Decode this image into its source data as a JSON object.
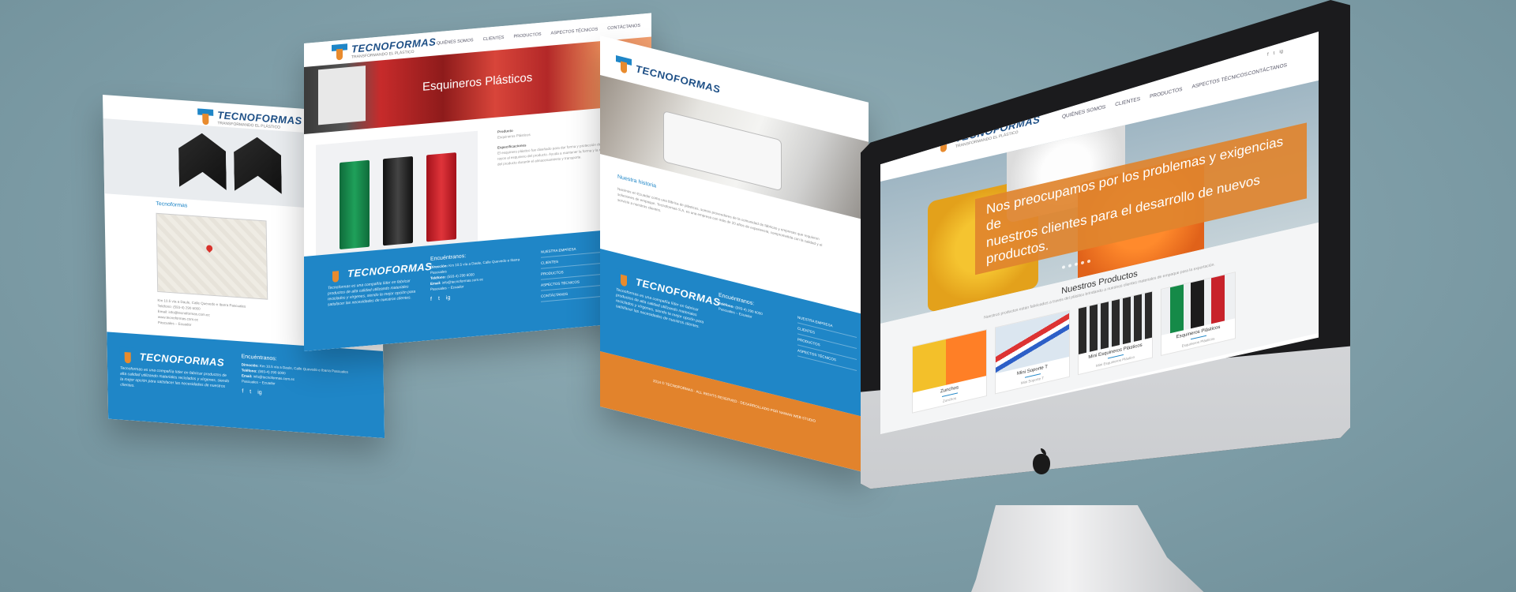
{
  "brand": {
    "name": "TECNOFORMAS",
    "tagline": "TRANSFORMANDO EL PLÁSTICO"
  },
  "nav": {
    "items": [
      "QUIÉNES SOMOS",
      "CLIENTES",
      "PRODUCTOS",
      "ASPECTOS TÉCNICOS",
      "CONTÁCTANOS"
    ]
  },
  "page_left": {
    "section_title": "Tecnoformas",
    "contact_lines": [
      "Km 10.5 vía a Daule, Calle Quevedo e Ibarra Pascuales",
      "Teléfono: (593-4) 290 6000",
      "Email: info@tecnoformas.com.ec",
      "www.tecnoformas.com.ec",
      "Pascuales – Ecuador"
    ]
  },
  "page_middle": {
    "hero_title": "Esquineros Plásticos",
    "product_label": "Producto",
    "product_name": "Esquineros Plásticos",
    "spec_label": "Especificaciones",
    "spec_text": "El esquinero plástico fue diseñado para dar forma y protección de los rayos al esquinero del producto. Ayuda a mantener la forma y la estructura del producto durante el almacenamiento y transporte."
  },
  "page_right": {
    "history_title": "Nuestra historia",
    "history_text": "Nacimos en Ecuador como una fábrica de plásticos, somos proveedores de la comunidad de fábricas y empresas que requieren soluciones de empaque. Tecnoformas S.A. es una empresa con más de 20 años de experiencia, comprometida con la calidad y el servicio a nuestros clientes.",
    "copyright": "2014 © TECNOFORMAS · ALL RIGHTS RESERVED · DESARROLLADO POR NAWAN WEB STUDIO"
  },
  "footer": {
    "description": "Tecnoformas es una compañía líder en fabricar productos de alta calidad utilizando materiales reciclados y vírgenes, siendo la mejor opción para satisfacer las necesidades de nuestros clientes.",
    "find_us_title": "Encuéntranos:",
    "address_label": "Dirección:",
    "address": "Km 10.5 vía a Daule, Calle Quevedo e Ibarra Pascuales",
    "phone_label": "Teléfono:",
    "phone": "(593-4) 290 6000",
    "email_label": "Email:",
    "email": "info@tecnoformas.com.ec",
    "city": "Pascuales – Ecuador",
    "links": [
      "NUESTRA EMPRESA",
      "CLIENTES",
      "PRODUCTOS",
      "ASPECTOS TÉCNICOS",
      "CONTÁCTANOS"
    ],
    "social_icons": [
      "f",
      "t",
      "ig"
    ]
  },
  "screen": {
    "banner_line1": "Nos preocupamos por los problemas y exigencias de",
    "banner_line2": "nuestros clientes para el desarrollo de nuevos productos.",
    "products_title": "Nuestros Productos",
    "products_subtitle": "Nuestros productos están fabricados a través del plástico brindando a nuestros clientes materiales de empaque para la exportación.",
    "products": [
      {
        "name": "Zunchos",
        "category": "Zunchos"
      },
      {
        "name": "Mini Soporte T",
        "category": "Mini Soporte T"
      },
      {
        "name": "Mini Esquineros Plásticos",
        "category": "Mini Esquineros Plástico"
      },
      {
        "name": "Esquineros Plásticos",
        "category": "Esquineros Plásticos"
      }
    ]
  },
  "colors": {
    "brand_blue": "#1f86c7",
    "brand_orange": "#e2832c",
    "background": "#86a6af"
  }
}
